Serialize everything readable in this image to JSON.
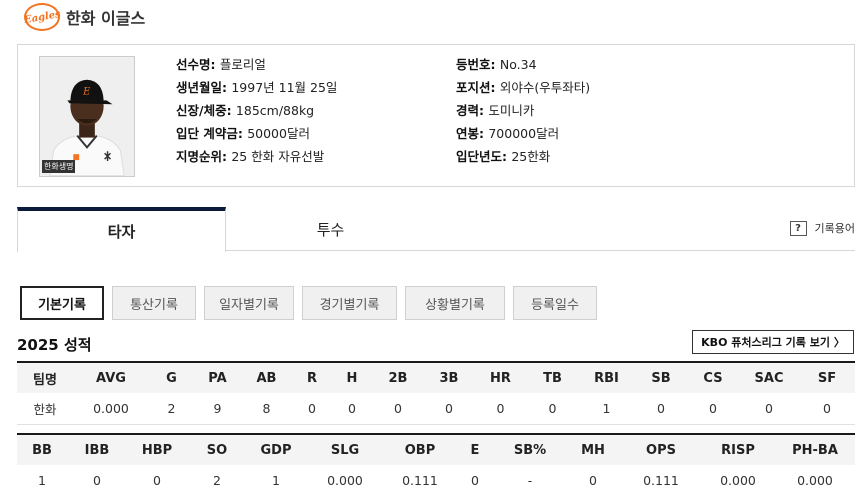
{
  "team": {
    "logo_text": "Eagles",
    "name": "한화 이글스"
  },
  "player": {
    "photo_tag": "한화생명",
    "left": [
      {
        "label": "선수명: ",
        "value": "플로리얼"
      },
      {
        "label": "생년월일: ",
        "value": "1997년 11월 25일"
      },
      {
        "label": "신장/체중: ",
        "value": "185cm/88kg"
      },
      {
        "label": "입단 계약금: ",
        "value": "50000달러"
      },
      {
        "label": "지명순위: ",
        "value": "25 한화 자유선발"
      }
    ],
    "right": [
      {
        "label": "등번호: ",
        "value": "No.34"
      },
      {
        "label": "포지션: ",
        "value": "외야수(우투좌타)"
      },
      {
        "label": "경력: ",
        "value": "도미니카"
      },
      {
        "label": "연봉: ",
        "value": "700000달러"
      },
      {
        "label": "입단년도: ",
        "value": "25한화"
      }
    ]
  },
  "tabs": {
    "batter": "타자",
    "pitcher": "투수"
  },
  "glossary": {
    "icon": "?",
    "label": "기록용어"
  },
  "subnav": [
    "기본기록",
    "통산기록",
    "일자별기록",
    "경기별기록",
    "상황별기록",
    "등록일수"
  ],
  "season_title": "2025 성적",
  "futures_button": "KBO 퓨처스리그 기록 보기 〉",
  "table1": {
    "headers": [
      "팀명",
      "AVG",
      "G",
      "PA",
      "AB",
      "R",
      "H",
      "2B",
      "3B",
      "HR",
      "TB",
      "RBI",
      "SB",
      "CS",
      "SAC",
      "SF"
    ],
    "row": [
      "한화",
      "0.000",
      "2",
      "9",
      "8",
      "0",
      "0",
      "0",
      "0",
      "0",
      "0",
      "1",
      "0",
      "0",
      "0",
      "0"
    ]
  },
  "table2": {
    "headers": [
      "BB",
      "IBB",
      "HBP",
      "SO",
      "GDP",
      "SLG",
      "OBP",
      "E",
      "SB%",
      "MH",
      "OPS",
      "RISP",
      "PH-BA"
    ],
    "row": [
      "1",
      "0",
      "0",
      "2",
      "1",
      "0.000",
      "0.111",
      "0",
      "-",
      "0",
      "0.111",
      "0.000",
      "0.000"
    ]
  },
  "colors": {
    "brand": "#f37321",
    "tab_active": "#0d1b3a"
  }
}
